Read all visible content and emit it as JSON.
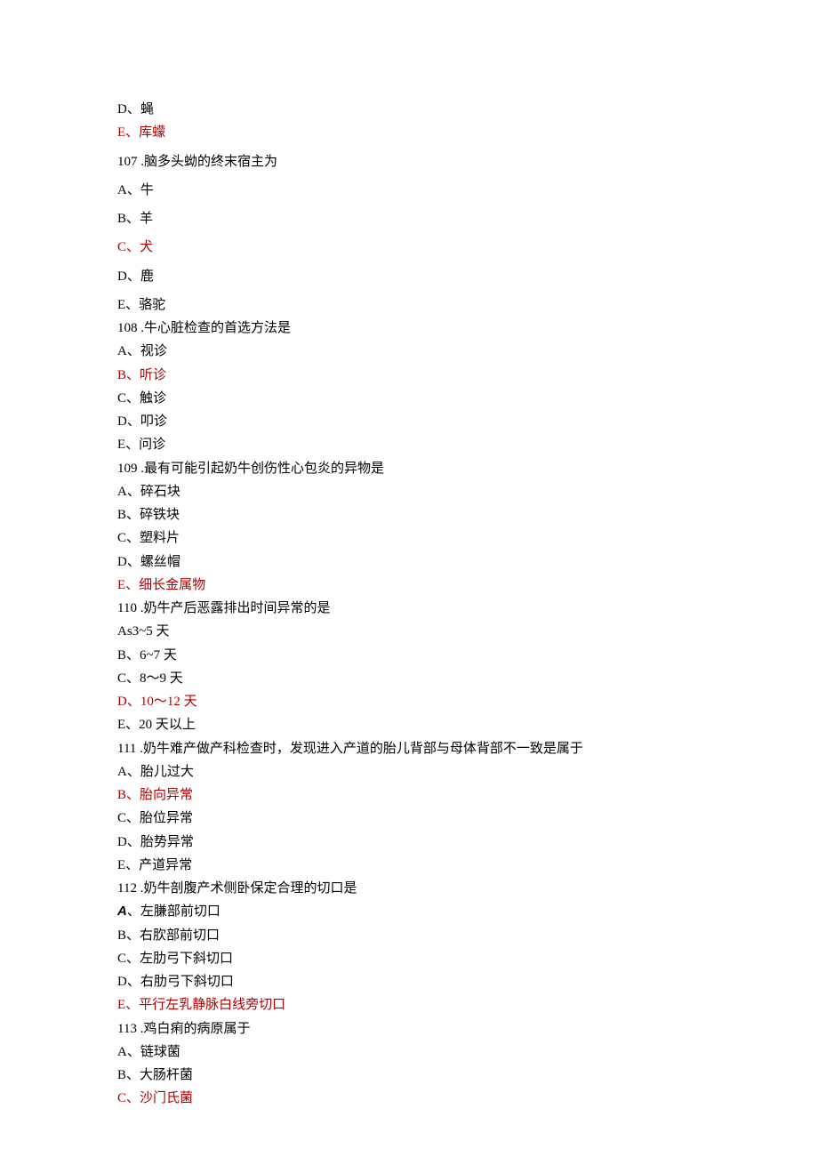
{
  "lines": [
    {
      "text": "D、蝇",
      "red": false,
      "letterClass": "option-letter"
    },
    {
      "text": "E、库蠓",
      "red": true,
      "letterClass": "option-letter",
      "spacerAfter": true
    },
    {
      "text": "107  .脑多头蚴的终末宿主为",
      "red": false,
      "letterClass": "num-text",
      "spacerAfter": true
    },
    {
      "text": "A、牛",
      "red": false,
      "letterClass": "option-letter",
      "spacerAfter": true
    },
    {
      "text": "B、羊",
      "red": false,
      "letterClass": "option-letter",
      "spacerAfter": true
    },
    {
      "text": "C、犬",
      "red": true,
      "letterClass": "option-letter",
      "spacerAfter": true
    },
    {
      "text": "D、鹿",
      "red": false,
      "letterClass": "option-letter",
      "spacerAfter": true
    },
    {
      "text": "E、骆驼",
      "red": false,
      "letterClass": "option-letter"
    },
    {
      "text": "108  .牛心脏检查的首选方法是",
      "red": false,
      "letterClass": "num-text"
    },
    {
      "text": "A、视诊",
      "red": false,
      "letterClass": "option-letter"
    },
    {
      "text": "B、听诊",
      "red": true,
      "letterClass": "option-letter"
    },
    {
      "text": "C、触诊",
      "red": false,
      "letterClass": "option-letter"
    },
    {
      "text": "D、叩诊",
      "red": false,
      "letterClass": "option-letter"
    },
    {
      "text": "E、问诊",
      "red": false,
      "letterClass": "option-letter"
    },
    {
      "text": "109  .最有可能引起奶牛创伤性心包炎的异物是",
      "red": false,
      "letterClass": "num-text"
    },
    {
      "text": "A、碎石块",
      "red": false,
      "letterClass": "option-letter"
    },
    {
      "text": "B、碎铁块",
      "red": false,
      "letterClass": "option-letter"
    },
    {
      "text": "C、塑料片",
      "red": false,
      "letterClass": "option-letter"
    },
    {
      "text": "D、螺丝帽",
      "red": false,
      "letterClass": "option-letter"
    },
    {
      "text": "E、细长金属物",
      "red": true,
      "letterClass": "option-letter"
    },
    {
      "text": "110  .奶牛产后恶露排出时间异常的是",
      "red": false,
      "letterClass": "num-text"
    },
    {
      "text": "As3~5 天",
      "red": false,
      "letterClass": "option-letter"
    },
    {
      "text": "B、6~7 天",
      "red": false,
      "letterClass": "option-letter"
    },
    {
      "text": "C、8～9 天",
      "red": false,
      "letterClass": "option-letter"
    },
    {
      "text": "D、10～12 天",
      "red": true,
      "letterClass": "option-letter"
    },
    {
      "text": "E、20 天以上",
      "red": false,
      "letterClass": "option-letter"
    },
    {
      "text": "111  .奶牛难产做产科检查时，发现进入产道的胎儿背部与母体背部不一致是属于",
      "red": false,
      "letterClass": "num-text"
    },
    {
      "text": "A、胎儿过大",
      "red": false,
      "letterClass": "option-letter"
    },
    {
      "text": "B、胎向异常",
      "red": true,
      "letterClass": "option-letter"
    },
    {
      "text": "C、胎位异常",
      "red": false,
      "letterClass": "option-letter"
    },
    {
      "text": "D、胎势异常",
      "red": false,
      "letterClass": "option-letter"
    },
    {
      "text": "E、产道异常",
      "red": false,
      "letterClass": "option-letter"
    },
    {
      "text": "112  .奶牛剖腹产术侧卧保定合理的切口是",
      "red": false,
      "letterClass": "num-text"
    },
    {
      "text": "A、左膁部前切口",
      "red": false,
      "letterClass": "italic-letter",
      "letterOnly": "A"
    },
    {
      "text": "B、右肷部前切口",
      "red": false,
      "letterClass": "option-letter"
    },
    {
      "text": "C、左肋弓下斜切口",
      "red": false,
      "letterClass": "option-letter"
    },
    {
      "text": "D、右肋弓下斜切口",
      "red": false,
      "letterClass": "option-letter"
    },
    {
      "text": "E、平行左乳静脉白线旁切口",
      "red": true,
      "letterClass": "option-letter"
    },
    {
      "text": "113  .鸡白痢的病原属于",
      "red": false,
      "letterClass": "num-text"
    },
    {
      "text": "A、链球菌",
      "red": false,
      "letterClass": "option-letter"
    },
    {
      "text": "B、大肠杆菌",
      "red": false,
      "letterClass": "option-letter"
    },
    {
      "text": "C、沙门氏菌",
      "red": true,
      "letterClass": "option-letter"
    }
  ]
}
